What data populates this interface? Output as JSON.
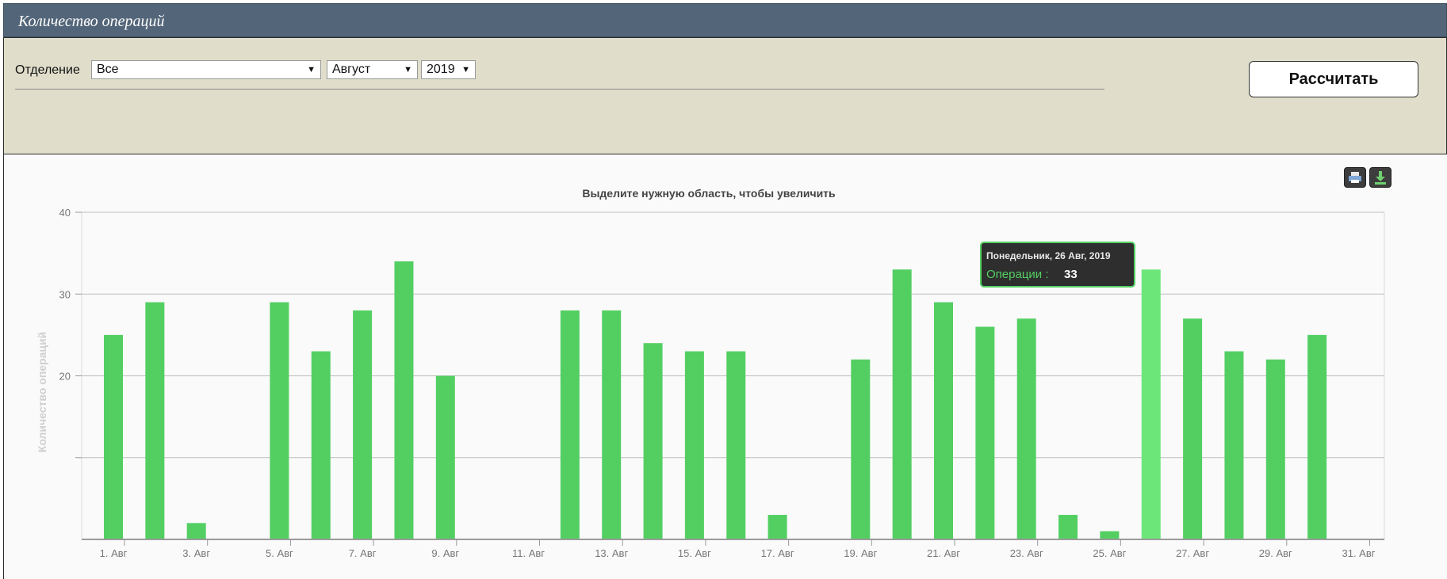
{
  "header": {
    "title": "Количество операций"
  },
  "filters": {
    "department_label": "Отделение",
    "department_value": "Все",
    "month_value": "Август",
    "year_value": "2019",
    "calculate_label": "Рассчитать"
  },
  "toolbar": {
    "print_icon": "printer-icon",
    "export_icon": "download-icon"
  },
  "colors": {
    "bar": "#53cf62",
    "bar_hover": "#6de679",
    "header_bg": "#536679",
    "filter_bg": "#e0decb"
  },
  "chart_data": {
    "type": "bar",
    "title": "Выделите нужную область, чтобы увеличить",
    "ylabel": "Количество операций",
    "xlabel": "",
    "ylim": [
      0,
      40
    ],
    "yticks": [
      20,
      30,
      40
    ],
    "grid": true,
    "categories": [
      "1. Авг",
      "2. Авг",
      "3. Авг",
      "4. Авг",
      "5. Авг",
      "6. Авг",
      "7. Авг",
      "8. Авг",
      "9. Авг",
      "10. Авг",
      "11. Авг",
      "12. Авг",
      "13. Авг",
      "14. Авг",
      "15. Авг",
      "16. Авг",
      "17. Авг",
      "18. Авг",
      "19. Авг",
      "20. Авг",
      "21. Авг",
      "22. Авг",
      "23. Авг",
      "24. Авг",
      "25. Авг",
      "26. Авг",
      "27. Авг",
      "28. Авг",
      "29. Авг",
      "30. Авг",
      "31. Авг"
    ],
    "tick_labels": [
      "1. Авг",
      "3. Авг",
      "5. Авг",
      "7. Авг",
      "9. Авг",
      "11. Авг",
      "13. Авг",
      "15. Авг",
      "17. Авг",
      "19. Авг",
      "21. Авг",
      "23. Авг",
      "25. Авг",
      "27. Авг",
      "29. Авг",
      "31. Авг"
    ],
    "series": [
      {
        "name": "Операции",
        "values": [
          25,
          29,
          2,
          0,
          29,
          23,
          28,
          34,
          20,
          0,
          0,
          28,
          28,
          24,
          23,
          23,
          3,
          0,
          22,
          33,
          29,
          26,
          27,
          3,
          1,
          33,
          27,
          23,
          22,
          25,
          0
        ]
      }
    ],
    "hover": {
      "index": 25
    }
  },
  "tooltip": {
    "title": "Понедельник, 26 Авг, 2019",
    "series_label": "Операции :",
    "value": "33"
  }
}
